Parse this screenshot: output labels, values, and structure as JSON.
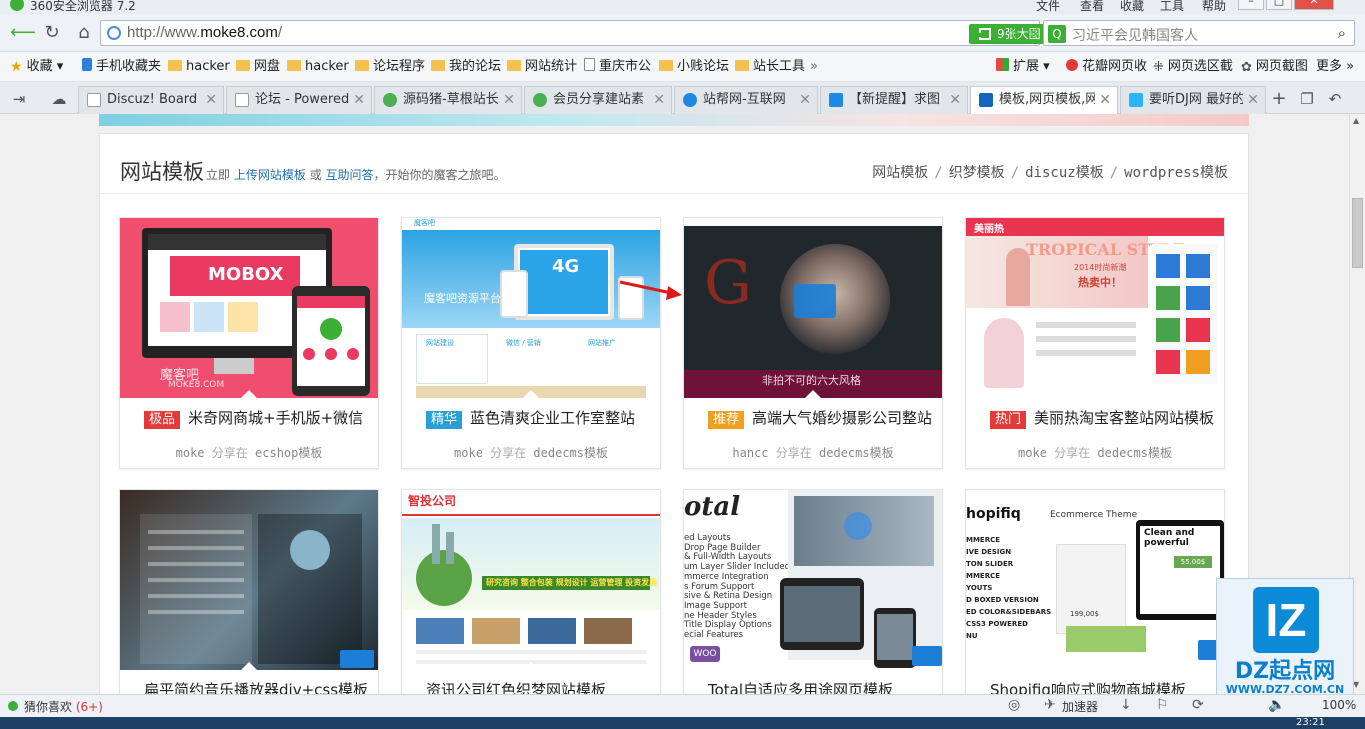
{
  "browser": {
    "title": "360安全浏览器 7.2",
    "menus": [
      "文件",
      "查看",
      "收藏",
      "工具",
      "帮助"
    ],
    "url_prefix": "http://www.",
    "url_domain": "moke8.com",
    "url_suffix": "/",
    "screenshot_btn": "9张大图",
    "search_query": "习近平会见韩国客人"
  },
  "bookmarks": [
    {
      "label": "收藏",
      "icon": "star-icon"
    },
    {
      "label": "手机收藏夹",
      "icon": "phone-icon"
    },
    {
      "label": "hacker",
      "icon": "folder-icon"
    },
    {
      "label": "网盘",
      "icon": "folder-icon"
    },
    {
      "label": "hacker",
      "icon": "folder-icon"
    },
    {
      "label": "论坛程序",
      "icon": "folder-icon"
    },
    {
      "label": "我的论坛",
      "icon": "folder-icon"
    },
    {
      "label": "网站统计",
      "icon": "folder-icon"
    },
    {
      "label": "重庆市公",
      "icon": "doc-icon"
    },
    {
      "label": "小贱论坛",
      "icon": "folder-icon"
    },
    {
      "label": "站长工具",
      "icon": "folder-icon"
    }
  ],
  "bookmark_tools": [
    {
      "label": "扩展",
      "icon": "grid-icon"
    },
    {
      "label": "花瓣网页收",
      "icon": "petal-icon"
    },
    {
      "label": "网页选区截",
      "icon": "select-icon"
    },
    {
      "label": "网页截图",
      "icon": "camera-icon"
    },
    {
      "label": "更多",
      "icon": "more-icon"
    }
  ],
  "tabs": [
    {
      "label": "Discuz! Board",
      "color": "#ffffff"
    },
    {
      "label": "论坛 - Powered",
      "color": "#ffffff"
    },
    {
      "label": "源码猪-草根站长",
      "color": "#4caf50"
    },
    {
      "label": "会员分享建站素",
      "color": "#4caf50"
    },
    {
      "label": "站帮网-互联网",
      "color": "#1e88e5"
    },
    {
      "label": "【新提醒】求图",
      "color": "#1e88e5"
    },
    {
      "label": "模板,网页模板,网",
      "color": "#1565c0"
    },
    {
      "label": "要听DJ网 最好的",
      "color": "#29b6f6"
    }
  ],
  "section": {
    "title": "网站模板",
    "intro_pre": "立即",
    "intro_link1": "上传网站模板",
    "intro_mid": "或",
    "intro_link2": "互助问答",
    "intro_post": "，开始你的魔客之旅吧。",
    "categories": [
      "网站模板",
      "织梦模板",
      "discuz模板",
      "wordpress模板"
    ]
  },
  "cards": [
    {
      "badge": "极品",
      "badge_color": "#e33a3a",
      "title": "米奇网商城+手机版+微信",
      "author": "moke",
      "shared": "分享在",
      "cat": "ecshop模板"
    },
    {
      "badge": "精华",
      "badge_color": "#2a9fd6",
      "title": "蓝色清爽企业工作室整站",
      "author": "moke",
      "shared": "分享在",
      "cat": "dedecms模板"
    },
    {
      "badge": "推荐",
      "badge_color": "#f0a020",
      "title": "高端大气婚纱摄影公司整站",
      "author": "hancc",
      "shared": "分享在",
      "cat": "dedecms模板"
    },
    {
      "badge": "热门",
      "badge_color": "#e33a3a",
      "title": "美丽热淘宝客整站网站模板",
      "author": "moke",
      "shared": "分享在",
      "cat": "dedecms模板"
    },
    {
      "badge": "",
      "badge_color": "",
      "title": "扁平简约音乐播放器div+css模板",
      "author": "",
      "shared": "",
      "cat": ""
    },
    {
      "badge": "",
      "badge_color": "",
      "title": "资讯公司红色织梦网站模板",
      "author": "",
      "shared": "",
      "cat": ""
    },
    {
      "badge": "",
      "badge_color": "",
      "title": "Total自适应多用途网页模板",
      "author": "",
      "shared": "",
      "cat": ""
    },
    {
      "badge": "",
      "badge_color": "",
      "title": "Shopifiq响应式购物商城模板",
      "author": "",
      "shared": "",
      "cat": ""
    }
  ],
  "thumb_text": {
    "t1_logo": "MOBOX",
    "t1_wm": "魔客吧",
    "t1_wm2": "MOKE8.COM",
    "t2_logo": "魔客吧",
    "t2_heading": "魔客吧资源平台",
    "t2_4g": "4G",
    "t2_sec1": "网站建设",
    "t2_sec2": "微信 / 营销",
    "t2_sec3": "网站推广",
    "t3_cn": "非拍不可的六大风格",
    "t4_brand": "美丽热",
    "t4_style": "TROPICAL STYLE",
    "t4_promo": "2014时尚新潮",
    "t4_promo2": "热卖中！",
    "t6_brand": "智投公司",
    "t6_banner": "研究咨询 整合包装 规划设计 运营管理 投资发展",
    "t7_brand": "otal",
    "t7_list": [
      "ed Layouts",
      "Drop Page Builder",
      "& Full-Width Layouts",
      "um Layer Slider Included",
      "mmerce Integration",
      "s Forum Support",
      "sive & Retina Design",
      "Image Support",
      "ne Header Styles",
      "Title Display Options",
      "ecial Features"
    ],
    "t7_woo": "WOO",
    "t8_brand": "hopifiq",
    "t8_sub": "Ecommerce Theme",
    "t8_list": [
      "MMERCE",
      "IVE DESIGN",
      "TON SLIDER",
      "MMERCE",
      "YOUTS",
      "D BOXED VERSION",
      "ED COLOR&SIDEBARS",
      "CSS3 POWERED",
      "NU"
    ],
    "t8_headline": "Clean and powerful",
    "t8_price": "55.00$",
    "t8_price2": "199,00$"
  },
  "watermark": {
    "letters": "IZ",
    "name": "DZ起点网",
    "url": "WWW.DZ7.COM.CN"
  },
  "status": {
    "guess": "猜你喜欢",
    "count": "(6+)",
    "accelerator": "加速器",
    "zoom": "100%",
    "clock": "23:21"
  }
}
